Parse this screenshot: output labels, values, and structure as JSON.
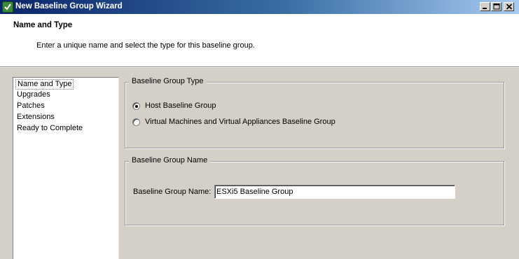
{
  "window": {
    "title": "New Baseline Group Wizard",
    "icon": "vsphere-update-manager-icon",
    "buttons": [
      "minimize-icon",
      "maximize-icon",
      "close-icon"
    ]
  },
  "header": {
    "title": "Name and Type",
    "description": "Enter a unique name and select the type for this baseline group."
  },
  "nav": {
    "items": [
      {
        "label": "Name and Type",
        "selected": true
      },
      {
        "label": "Upgrades",
        "selected": false
      },
      {
        "label": "Patches",
        "selected": false
      },
      {
        "label": "Extensions",
        "selected": false
      },
      {
        "label": "Ready to Complete",
        "selected": false
      }
    ]
  },
  "type_group": {
    "legend": "Baseline Group Type",
    "options": [
      {
        "label": "Host Baseline Group",
        "checked": true
      },
      {
        "label": "Virtual Machines and Virtual Appliances Baseline Group",
        "checked": false
      }
    ]
  },
  "name_group": {
    "legend": "Baseline Group Name",
    "field_label": "Baseline Group Name:",
    "value": "ESXi5 Baseline Group"
  },
  "colors": {
    "titlebar_start": "#0a246a",
    "titlebar_end": "#a6caf0",
    "dialog_bg": "#d4d0c8"
  }
}
